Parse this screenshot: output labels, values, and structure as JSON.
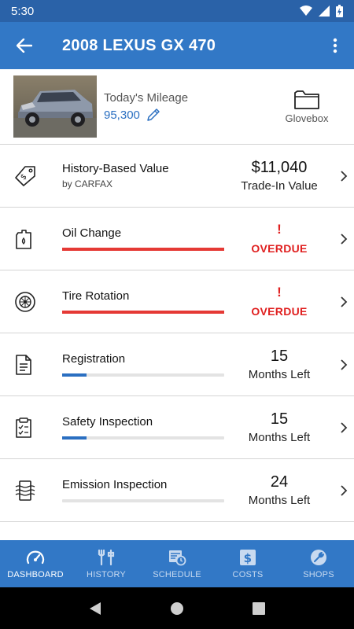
{
  "status_bar": {
    "time": "5:30"
  },
  "app_bar": {
    "title": "2008 LEXUS GX 470"
  },
  "vehicle": {
    "mileage_label": "Today's Mileage",
    "mileage_value": "95,300",
    "glovebox_label": "Glovebox"
  },
  "items": [
    {
      "name": "History-Based Value",
      "sub": "by CARFAX",
      "value": "$11,040",
      "caption": "Trade-In Value",
      "icon": "price-tag-icon"
    },
    {
      "name": "Oil Change",
      "status": "OVERDUE",
      "alert": "!",
      "progress": 1.0,
      "bar_color": "#e53935",
      "icon": "oil-jug-icon"
    },
    {
      "name": "Tire Rotation",
      "status": "OVERDUE",
      "alert": "!",
      "progress": 1.0,
      "bar_color": "#e53935",
      "icon": "tire-icon"
    },
    {
      "name": "Registration",
      "value": "15",
      "caption": "Months Left",
      "progress": 0.15,
      "bar_color": "#2a6fc1",
      "icon": "document-icon"
    },
    {
      "name": "Safety Inspection",
      "value": "15",
      "caption": "Months Left",
      "progress": 0.15,
      "bar_color": "#2a6fc1",
      "icon": "clipboard-check-icon"
    },
    {
      "name": "Emission Inspection",
      "value": "24",
      "caption": "Months Left",
      "progress": 0.0,
      "bar_color": "#2a6fc1",
      "icon": "emission-icon"
    }
  ],
  "bottom_nav": {
    "tabs": [
      {
        "label": "DASHBOARD",
        "icon": "speedometer-icon",
        "active": true
      },
      {
        "label": "HISTORY",
        "icon": "tools-icon",
        "active": false
      },
      {
        "label": "SCHEDULE",
        "icon": "calendar-clock-icon",
        "active": false
      },
      {
        "label": "COSTS",
        "icon": "dollar-icon",
        "active": false
      },
      {
        "label": "SHOPS",
        "icon": "wrench-icon",
        "active": false
      }
    ]
  },
  "colors": {
    "primary": "#3278c6",
    "status_bar": "#2a62a8",
    "alert": "#e02020",
    "progress": "#2a6fc1"
  }
}
